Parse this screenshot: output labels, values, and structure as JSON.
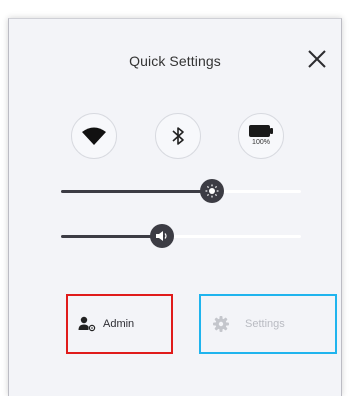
{
  "panel": {
    "title": "Quick Settings"
  },
  "toggles": {
    "wifi": {
      "icon": "wifi-icon",
      "enabled": true
    },
    "bluetooth": {
      "icon": "bluetooth-icon",
      "enabled": true
    },
    "battery": {
      "icon": "battery-icon",
      "text": "100%",
      "level": 1.0
    }
  },
  "sliders": {
    "brightness": {
      "icon": "sun-icon",
      "value": 0.63
    },
    "volume": {
      "icon": "speaker-icon",
      "value": 0.42
    }
  },
  "buttons": {
    "admin": {
      "label": "Admin",
      "icon": "user-gear-icon",
      "highlight": "#e01b1b"
    },
    "settings": {
      "label": "Settings",
      "icon": "gear-icon",
      "disabled": true,
      "highlight": "#1fb4ee"
    }
  },
  "colors": {
    "panel_bg": "#f3f4f8",
    "dark": "#3c3c44"
  }
}
